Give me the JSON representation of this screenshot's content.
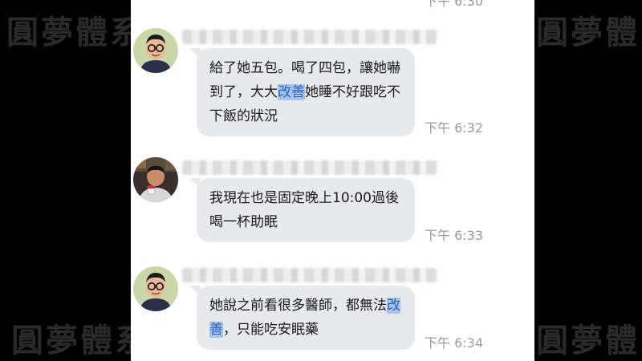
{
  "watermark": "圓夢體系",
  "top_time": "下午 6:30",
  "messages": [
    {
      "pre": "給了她五包。喝了四包，讓她嚇到了，大大",
      "highlight": "改善",
      "post": "她睡不好跟吃不下飯的狀況",
      "time": "下午 6:32"
    },
    {
      "pre": "我現在也是固定晚上10:00過後喝一杯助眠",
      "highlight": "",
      "post": "",
      "time": "下午 6:33"
    },
    {
      "pre": "她說之前看很多醫師，都無法",
      "highlight": "改善",
      "post": "，只能吃安眠藥",
      "time": "下午 6:34"
    }
  ],
  "colors": {
    "bubble": "#e7e9ec",
    "highlight_bg": "#a9c4ec",
    "highlight_text": "#2f63c0",
    "time_text": "#9a9a9a"
  },
  "icons": [
    "avatar-glasses-man",
    "avatar-man-holding-cup"
  ]
}
